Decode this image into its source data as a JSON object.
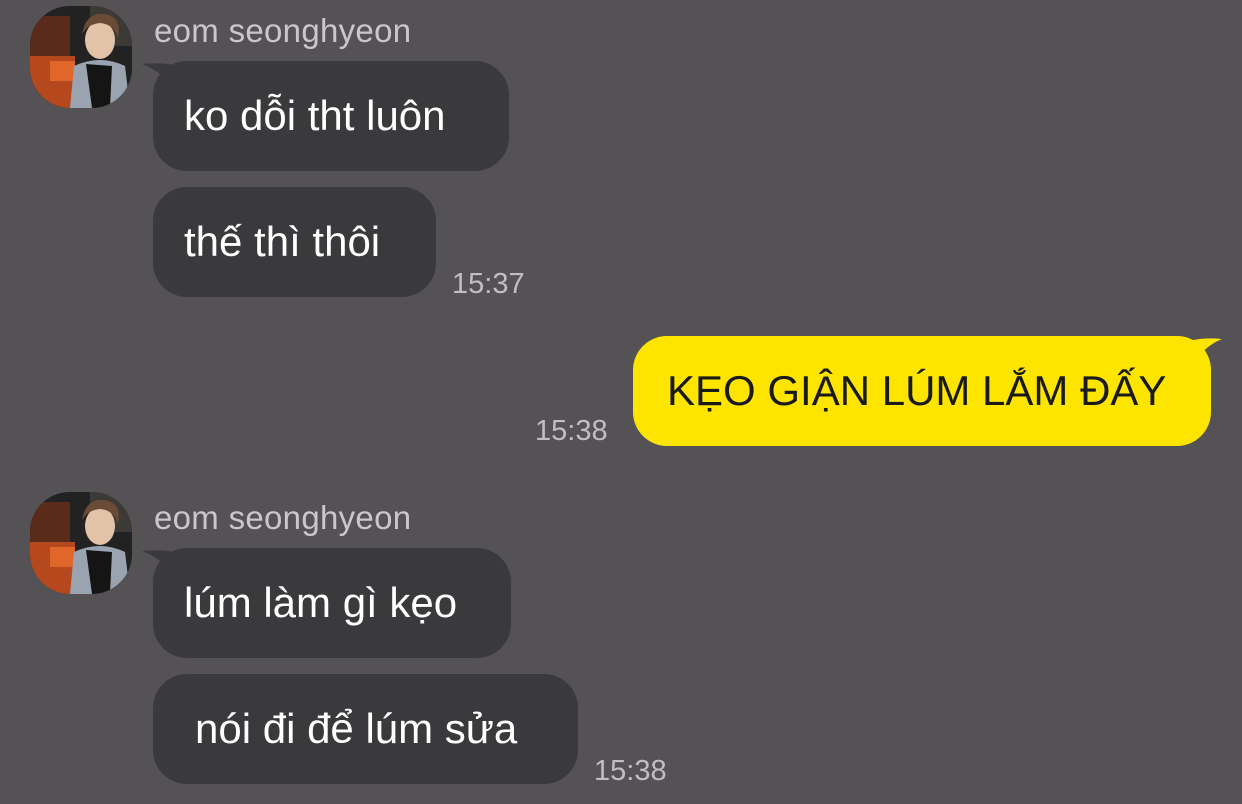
{
  "groups": [
    {
      "sender": "eom seonghyeon",
      "avatar": "profile-photo",
      "messages": [
        {
          "text": "ko dỗi tht luôn"
        },
        {
          "text": "thế thì thôi"
        }
      ],
      "time": "15:37"
    },
    {
      "sender": "me",
      "messages": [
        {
          "text": "KẸO GIẬN LÚM LẮM ĐẤY"
        }
      ],
      "time": "15:38"
    },
    {
      "sender": "eom seonghyeon",
      "avatar": "profile-photo",
      "messages": [
        {
          "text": "lúm làm gì kẹo"
        },
        {
          "text": "nói đi để lúm sửa"
        }
      ],
      "time": "15:38"
    }
  ],
  "colors": {
    "background": "#545255",
    "incoming_bubble": "#3a393c",
    "outgoing_bubble": "#fee500"
  }
}
